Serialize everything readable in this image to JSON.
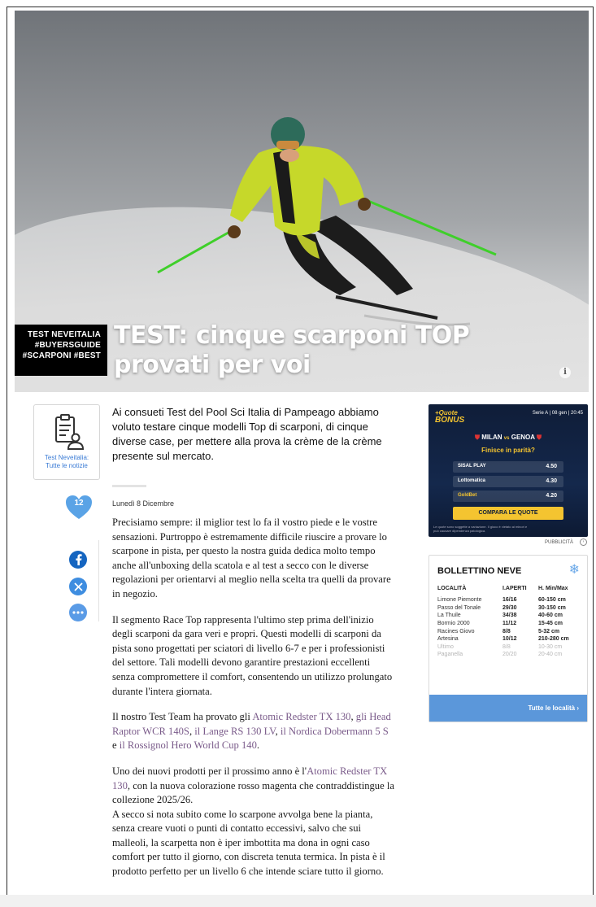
{
  "hero": {
    "tags": [
      "TEST NEVEITALIA",
      "#BUYERSGUIDE",
      "#SCARPONI #BEST"
    ],
    "title_lines": [
      "TEST: cinque scarponi TOP",
      "provati per voi"
    ],
    "info_icon": "i"
  },
  "author": {
    "icon": "editor-document-person-icon",
    "label_lines": [
      "Test Neveitalia:",
      "Tutte le notizie"
    ]
  },
  "likes": {
    "count": "12",
    "color": "#5aa3e6"
  },
  "article": {
    "lead": "Ai consueti Test del Pool Sci Italia di Pampeago abbiamo voluto testare cinque modelli Top di scarponi, di cinque diverse case, per mettere alla prova la crème de la crème presente sul mercato.",
    "date": "Lunedì 8 Dicembre",
    "p1": "Precisiamo sempre: il miglior test lo fa il vostro piede e le vostre sensazioni. Purtroppo è estremamente difficile riuscire a provare lo scarpone in pista, per questo la nostra guida dedica molto tempo anche all'unboxing della scatola e al test a secco con le diverse regolazioni per orientarvi al meglio nella scelta tra quelli da provare in negozio.",
    "p2": "Il segmento Race Top rappresenta l'ultimo step prima dell'inizio degli scarponi da gara  veri e propri.  Questi modelli di scarponi da pista sono progettati per sciatori di livello 6-7 e per i professionisti del settore.  Tali modelli devono garantire prestazioni eccellenti senza compromettere il comfort, consentendo un utilizzo prolungato durante l'intera giornata.",
    "p3_intro": "Il nostro Test Team ha provato gli ",
    "p3_links": [
      "Atomic Redster TX 130",
      "gli Head Raptor WCR 140S",
      "il Lange RS 130 LV",
      "il Nordica Dobermann 5 S",
      "il Rossignol Hero World Cup 140"
    ],
    "p3_seps": [
      ", ",
      ", ",
      ", ",
      " e "
    ],
    "p3_end": ".",
    "p4_intro": "Uno dei nuovi prodotti per il prossimo anno è l'",
    "p4_link": "Atomic Redster TX 130",
    "p4_rest": ", con la nuova colorazione rosso magenta che contraddistingue la collezione 2025/26.",
    "p5": "A secco si nota subito come lo scarpone avvolga bene la pianta, senza creare vuoti o punti di contatto eccessivi, salvo che sui malleoli, la scarpetta non è iper imbottita ma dona in ogni caso comfort per tutto il giorno, con discreta tenuta termica. In pista è il prodotto perfetto per un livello 6 che intende sciare tutto il giorno."
  },
  "social": {
    "facebook": "facebook-icon",
    "x": "x-icon",
    "more": "more-icon"
  },
  "ad": {
    "brand_lines": [
      "+Quote",
      "BONUS"
    ],
    "league": "Serie A | 08 gen | 20:45",
    "home": "MILAN",
    "vs": "vs",
    "away": "GENOA",
    "question": "Finisce in parità?",
    "odds": [
      {
        "bookmaker": "SISAL PLAY",
        "value": "4.50"
      },
      {
        "bookmaker": "Lottomatica",
        "value": "4.30"
      },
      {
        "bookmaker": "GoldBet",
        "value": "4.20"
      }
    ],
    "cta": "COMPARA LE QUOTE",
    "fine_print": "Le quote sono soggette a variazione. Il gioco è vietato ai minori e può causare dipendenza patologica.",
    "label": "PUBBLICITÀ"
  },
  "snow": {
    "title": "BOLLETTINO NEVE",
    "headers": [
      "LOCALITÀ",
      "I.APERTI",
      "H. Min/Max"
    ],
    "rows": [
      [
        "Limone Piemonte",
        "16/16",
        "60-150 cm"
      ],
      [
        "Passo del Tonale",
        "29/30",
        "30-150 cm"
      ],
      [
        "La Thuile",
        "34/38",
        "40-60 cm"
      ],
      [
        "Bormio 2000",
        "11/12",
        "15-45 cm"
      ],
      [
        "Racines Giovo",
        "8/8",
        "5-32 cm"
      ],
      [
        "Artesina",
        "10/12",
        "210-280 cm"
      ],
      [
        "Ultimo",
        "8/8",
        "10-30 cm"
      ],
      [
        "Paganella",
        "20/20",
        "20-40 cm"
      ]
    ],
    "cta": "Tutte le località  ›"
  }
}
